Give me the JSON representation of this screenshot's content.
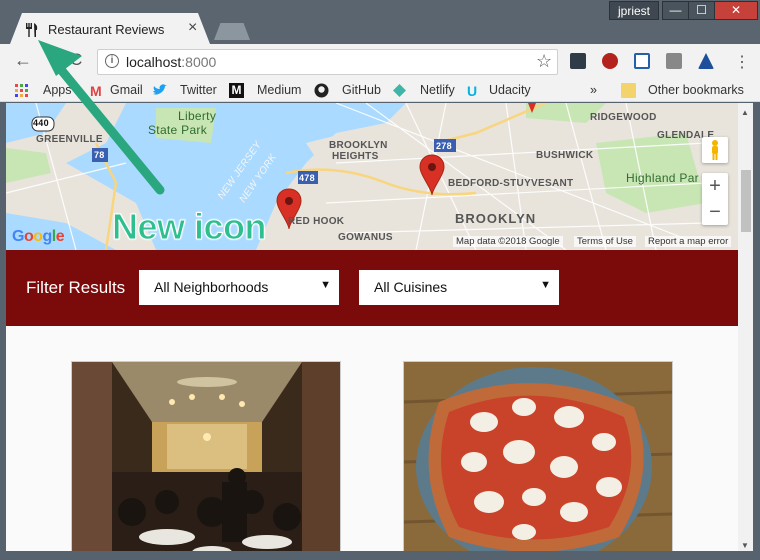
{
  "window": {
    "user": "jpriest",
    "minimize": "—",
    "maximize": "☐",
    "close": "✕"
  },
  "tab": {
    "title": "Restaurant Reviews",
    "close": "×"
  },
  "toolbar": {
    "back": "←",
    "reload": "C",
    "url_host": "localhost",
    "url_port": ":8000",
    "info": "i",
    "star": "☆",
    "menu": "⋮"
  },
  "bookmarks": {
    "items": [
      "Apps",
      "Gmail",
      "Twitter",
      "Medium",
      "GitHub",
      "Netlify",
      "Udacity"
    ],
    "overflow": "»",
    "other": "Other bookmarks"
  },
  "map": {
    "labels": {
      "greenville": "GREENVILLE",
      "liberty": "Liberty",
      "state_park": "State Park",
      "brooklyn_heights_1": "BROOKLYN",
      "brooklyn_heights_2": "HEIGHTS",
      "bushwick": "BUSHWICK",
      "bed_stuy": "BEDFORD-STUYVESANT",
      "brooklyn": "BROOKLYN",
      "red_hook": "RED HOOK",
      "gowanus": "GOWANUS",
      "ridgewood": "RIDGEWOOD",
      "glendale": "GLENDALE",
      "highland_park": "Highland Par",
      "new_jersey": "NEW JERSEY",
      "new_york": "NEW YORK",
      "hw_440": "440",
      "hw_78": "78",
      "hw_478": "478",
      "hw_278": "278"
    },
    "google": "Google",
    "map_data": "Map data ©2018 Google",
    "terms": "Terms of Use",
    "report": "Report a map error",
    "zoom_in": "+",
    "zoom_out": "−"
  },
  "filter": {
    "label": "Filter Results",
    "neighborhoods": "All Neighborhoods",
    "cuisines": "All Cuisines",
    "caret": "▼"
  },
  "annotation": {
    "text": "New icon"
  },
  "colors": {
    "filter_bg": "#7b0a0a",
    "annotation": "#2fbf8f",
    "marker": "#d93025"
  }
}
